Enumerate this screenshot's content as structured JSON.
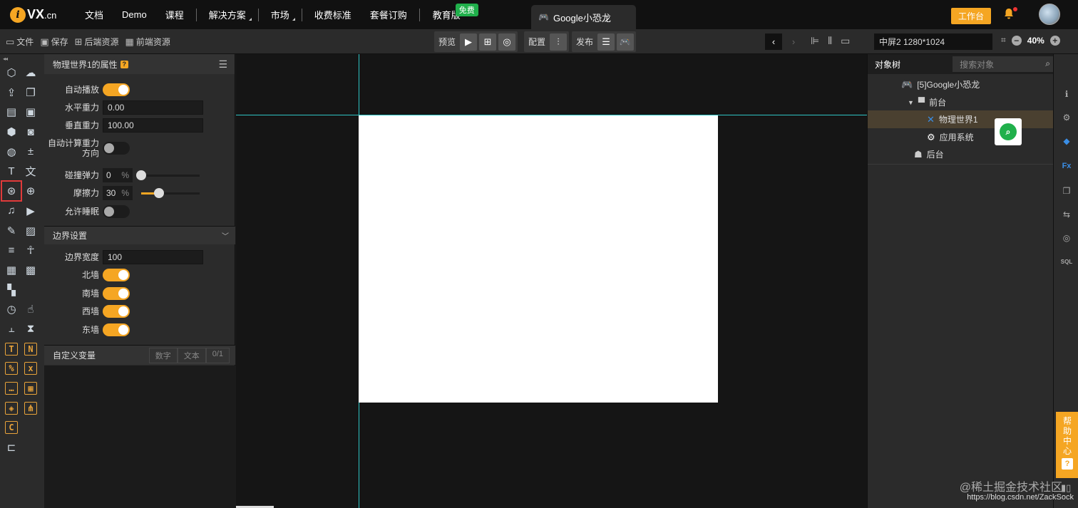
{
  "topnav": {
    "logo_mark": "i",
    "logo_text": "VX",
    "logo_suffix": ".cn",
    "items": [
      "文档",
      "Demo",
      "课程",
      "解决方案",
      "市场",
      "收费标准",
      "套餐订购",
      "教育版"
    ],
    "free_badge": "免费",
    "doc_tab": "Google小恐龙",
    "workbench": "工作台"
  },
  "toolbar": {
    "file": "文件",
    "save": "保存",
    "backend_res": "后端资源",
    "frontend_res": "前端资源",
    "preview": "预览",
    "config": "配置",
    "publish": "发布",
    "screen": "中屏2 1280*1024",
    "zoom": "40%"
  },
  "props": {
    "title": "物理世界1的属性",
    "help": "?",
    "rows": {
      "autoplay": "自动播放",
      "h_gravity": "水平重力",
      "h_gravity_val": "0.00",
      "v_gravity": "垂直重力",
      "v_gravity_val": "100.00",
      "auto_gravity_1": "自动计算重力",
      "auto_gravity_2": "方向",
      "bounce": "碰撞弹力",
      "bounce_val": "0",
      "friction": "摩擦力",
      "friction_val": "30",
      "percent": "%",
      "sleep": "允许睡眠"
    },
    "toggles": {
      "autoplay": true,
      "auto_gravity": false,
      "sleep": false
    },
    "border_section": "边界设置",
    "border_width": "边界宽度",
    "border_width_val": "100",
    "walls": [
      "北墙",
      "南墙",
      "西墙",
      "东墙"
    ],
    "custom_vars": "自定义变量",
    "var_tabs": [
      "数字",
      "文本",
      "0/1"
    ]
  },
  "sliders": {
    "bounce": 0,
    "friction": 30
  },
  "objtree": {
    "title": "对象树",
    "search_placeholder": "搜索对象",
    "root": "[5]Google小恐龙",
    "front": "前台",
    "physics": "物理世界1",
    "appsys": "应用系统",
    "back": "后台"
  },
  "help": {
    "chars": [
      "帮",
      "助",
      "中",
      "心"
    ],
    "q": "?"
  },
  "watermark": {
    "line1": "@稀土掘金技术社区",
    "line2": "https://blog.csdn.net/ZackSock"
  },
  "colors": {
    "accent": "#f5a623",
    "guide": "#2ec4c4",
    "badge": "#20b04b",
    "selected_outline": "#e03a3a"
  }
}
